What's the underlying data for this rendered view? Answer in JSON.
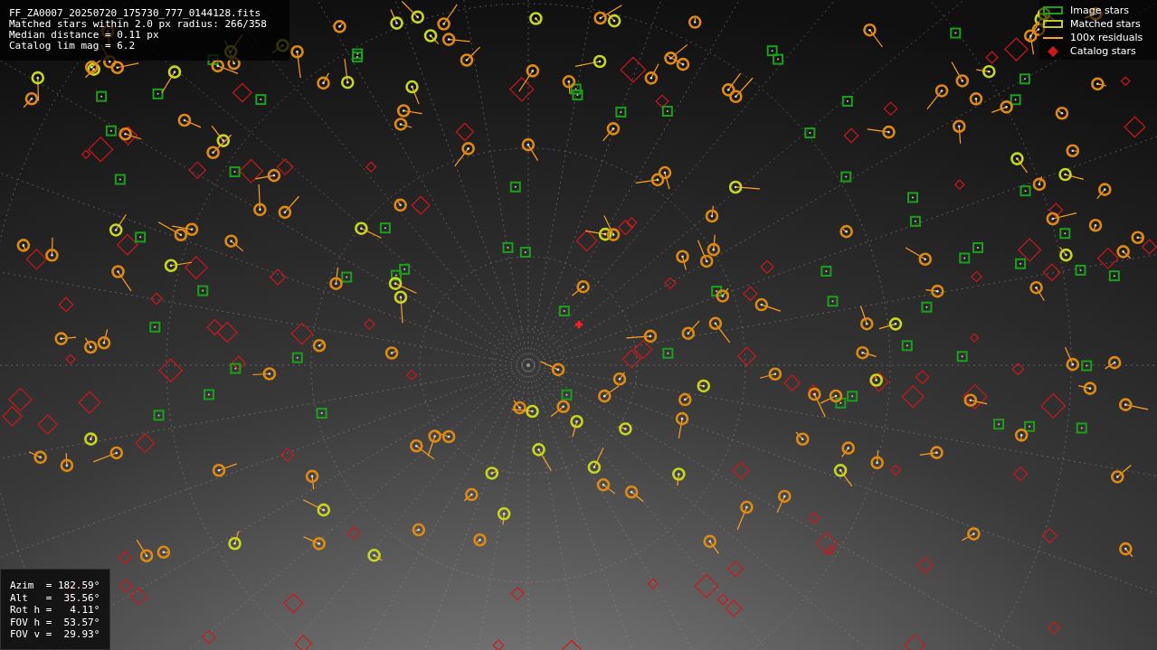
{
  "image": {
    "file_name": "FF_ZA0007_20250720_175730_777_0144128.fits",
    "info_lines": [
      "Matched stars within 2.0 px radius: 266/358",
      "Median distance = 0.11 px",
      "Catalog lim mag = 6.2"
    ]
  },
  "legend": [
    {
      "kind": "box",
      "color": "#1aa01a",
      "label": "Image stars"
    },
    {
      "kind": "box",
      "color": "#c8c81a",
      "label": "Matched stars"
    },
    {
      "kind": "line",
      "color": "#ffa020",
      "label": "100x residuals"
    },
    {
      "kind": "diamond",
      "color": "#d01818",
      "label": "Catalog stars"
    }
  ],
  "pointing": [
    "Azim  = 182.59°",
    "Alt   =  35.56°",
    "Rot h =   4.11°",
    "FOV h =  53.57°",
    "FOV v =  29.93°"
  ]
}
